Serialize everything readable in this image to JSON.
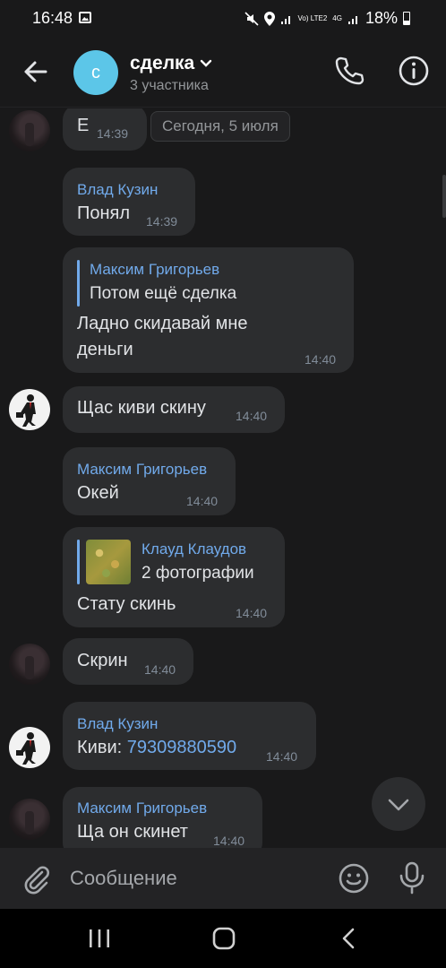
{
  "status_bar": {
    "time": "16:48",
    "network": "4G",
    "lte": "Vo) LTE2",
    "battery": "18%"
  },
  "header": {
    "avatar_letter": "с",
    "title": "сделка",
    "subtitle": "3 участника",
    "avatar_color": "#5cc6e8"
  },
  "chat": {
    "date_chip": "Сегодня, 5 июля",
    "messages": [
      {
        "text": "Е",
        "time": "14:39"
      },
      {
        "sender": "Влад Кузин",
        "text": "Понял",
        "time": "14:39"
      },
      {
        "sender": "Максим Григорьев",
        "reply_text": "Потом ещё сделка",
        "text_line1": "Ладно скидавай мне",
        "text_line2": "деньги",
        "time": "14:40"
      },
      {
        "text": "Щас киви скину",
        "time": "14:40"
      },
      {
        "sender": "Максим Григорьев",
        "text": "Окей",
        "time": "14:40"
      },
      {
        "reply_name": "Клауд Клаудов",
        "reply_text": "2 фотографии",
        "text": "Стату скинь",
        "time": "14:40"
      },
      {
        "text": "Скрин",
        "time": "14:40"
      },
      {
        "sender": "Влад Кузин",
        "text_prefix": "Киви: ",
        "link": "79309880590",
        "time": "14:40"
      },
      {
        "sender": "Максим Григорьев",
        "text": "Ща он скинет",
        "time": "14:40"
      }
    ]
  },
  "composer": {
    "placeholder": "Сообщение"
  },
  "colors": {
    "background": "#19191a",
    "bubble": "#2c2d2f",
    "accent": "#71aaeb",
    "muted": "#818c99"
  }
}
